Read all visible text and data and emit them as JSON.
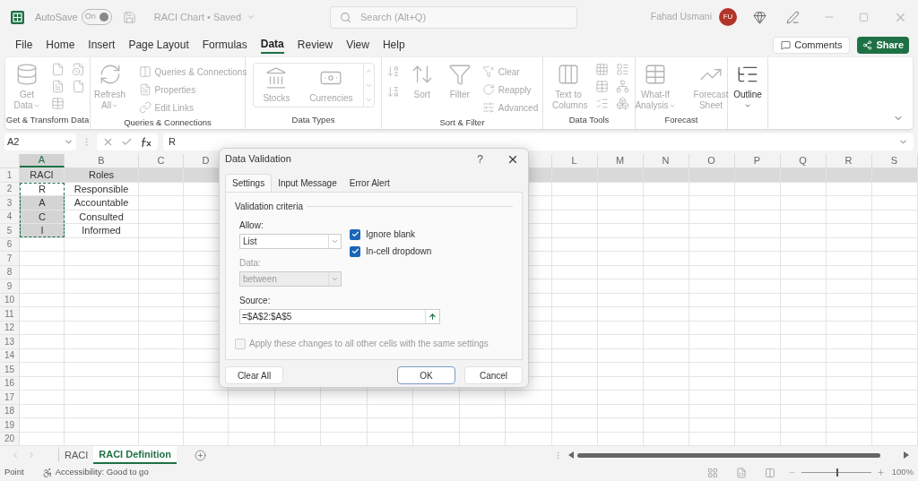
{
  "title_bar": {
    "autosave": {
      "label": "AutoSave",
      "toggle_label": "On",
      "on": true
    },
    "document_title": "RACI Chart • Saved",
    "search": {
      "placeholder": "Search (Alt+Q)"
    },
    "user_name": "Fahad Usmani",
    "avatar_initials": "FU"
  },
  "menu_tabs": [
    {
      "label": "File",
      "selected": false
    },
    {
      "label": "Home",
      "selected": false
    },
    {
      "label": "Insert",
      "selected": false
    },
    {
      "label": "Page Layout",
      "selected": false
    },
    {
      "label": "Formulas",
      "selected": false
    },
    {
      "label": "Data",
      "selected": true
    },
    {
      "label": "Review",
      "selected": false
    },
    {
      "label": "View",
      "selected": false
    },
    {
      "label": "Help",
      "selected": false
    }
  ],
  "comments_button": "Comments",
  "share_button": "Share",
  "ribbon": {
    "groups": [
      {
        "label": "Get & Transform Data",
        "items": [
          {
            "label": "Get Data",
            "disabled": true
          }
        ]
      },
      {
        "label": "Queries & Connections",
        "items": [
          {
            "label": "Refresh All",
            "disabled": true
          },
          {
            "label": "Queries & Connections",
            "disabled": true
          },
          {
            "label": "Properties",
            "disabled": true
          },
          {
            "label": "Edit Links",
            "disabled": true
          }
        ]
      },
      {
        "label": "Data Types",
        "items": [
          {
            "label": "Stocks",
            "disabled": true
          },
          {
            "label": "Currencies",
            "disabled": true
          }
        ]
      },
      {
        "label": "Sort & Filter",
        "items": [
          {
            "label": "Sort",
            "disabled": true
          },
          {
            "label": "Filter",
            "disabled": true
          },
          {
            "label": "Clear",
            "disabled": true
          },
          {
            "label": "Reapply",
            "disabled": true
          },
          {
            "label": "Advanced",
            "disabled": true
          }
        ]
      },
      {
        "label": "Data Tools",
        "items": [
          {
            "label": "Text to Columns",
            "disabled": true
          }
        ]
      },
      {
        "label": "Forecast",
        "items": [
          {
            "label": "What-If Analysis",
            "disabled": true
          },
          {
            "label": "Forecast Sheet",
            "disabled": true
          }
        ]
      },
      {
        "items": [
          {
            "label": "Outline",
            "disabled": false
          }
        ]
      }
    ]
  },
  "grid": {
    "name_box": "A2",
    "formula": "R",
    "columns_left": [
      {
        "label": "A",
        "selected": true
      },
      {
        "label": "B",
        "selected": false
      },
      {
        "label": "C",
        "selected": false
      },
      {
        "label": "D",
        "selected": false
      }
    ],
    "columns_right": [
      {
        "label": "L",
        "selected": false
      },
      {
        "label": "M",
        "selected": false
      },
      {
        "label": "N",
        "selected": false
      },
      {
        "label": "O",
        "selected": false
      },
      {
        "label": "P",
        "selected": false
      },
      {
        "label": "Q",
        "selected": false
      },
      {
        "label": "R",
        "selected": false
      },
      {
        "label": "S",
        "selected": false
      }
    ],
    "rows": [
      {
        "number": "1",
        "kind": "header",
        "cells": [
          {
            "text": "RACI",
            "selected": false,
            "active": false
          },
          {
            "text": "Roles",
            "selected": false
          }
        ]
      },
      {
        "number": "2",
        "kind": "data",
        "cells": [
          {
            "text": "R",
            "selected": true,
            "active": true
          },
          {
            "text": "Responsible",
            "selected": false
          }
        ]
      },
      {
        "number": "3",
        "kind": "data",
        "cells": [
          {
            "text": "A",
            "selected": true,
            "active": false
          },
          {
            "text": "Accountable",
            "selected": false
          }
        ]
      },
      {
        "number": "4",
        "kind": "data",
        "cells": [
          {
            "text": "C",
            "selected": true,
            "active": false
          },
          {
            "text": "Consulted",
            "selected": false
          }
        ]
      },
      {
        "number": "5",
        "kind": "data",
        "cells": [
          {
            "text": "I",
            "selected": true,
            "active": false
          },
          {
            "text": "Informed",
            "selected": false
          }
        ]
      },
      {
        "number": "6",
        "kind": "data"
      },
      {
        "number": "7",
        "kind": "data"
      },
      {
        "number": "8",
        "kind": "data"
      },
      {
        "number": "9",
        "kind": "data"
      },
      {
        "number": "10",
        "kind": "data"
      },
      {
        "number": "11",
        "kind": "data"
      },
      {
        "number": "12",
        "kind": "data"
      },
      {
        "number": "13",
        "kind": "data"
      },
      {
        "number": "14",
        "kind": "data"
      },
      {
        "number": "15",
        "kind": "data"
      },
      {
        "number": "16",
        "kind": "data"
      },
      {
        "number": "17",
        "kind": "data"
      },
      {
        "number": "18",
        "kind": "data"
      },
      {
        "number": "19",
        "kind": "data"
      },
      {
        "number": "20",
        "kind": "data"
      }
    ]
  },
  "dialog": {
    "title": "Data Validation",
    "help": "?",
    "tabs": [
      {
        "label": "Settings",
        "selected": true
      },
      {
        "label": "Input Message",
        "selected": false
      },
      {
        "label": "Error Alert",
        "selected": false
      }
    ],
    "section_title": "Validation criteria",
    "allow": {
      "label": "Allow:",
      "value": "List"
    },
    "ignore_blank": {
      "label": "Ignore blank",
      "checked": true
    },
    "in_cell_dropdown": {
      "label": "In-cell dropdown",
      "checked": true
    },
    "data": {
      "label": "Data:",
      "value": "between",
      "disabled": true
    },
    "source": {
      "label": "Source:",
      "value": "=$A$2:$A$5"
    },
    "apply_all": {
      "label": "Apply these changes to all other cells with the same settings",
      "checked": false,
      "disabled": true
    },
    "buttons": [
      {
        "label": "Clear All",
        "default": false
      },
      {
        "label": "OK",
        "default": true
      },
      {
        "label": "Cancel",
        "default": false
      }
    ]
  },
  "sheet_tabs": [
    {
      "label": "RACI",
      "selected": false
    },
    {
      "label": "RACI Definition",
      "selected": true
    }
  ],
  "status_bar": {
    "mode": "Point",
    "accessibility": "Accessibility: Good to go",
    "zoom": {
      "level": 0.5,
      "reading": "100%"
    }
  }
}
